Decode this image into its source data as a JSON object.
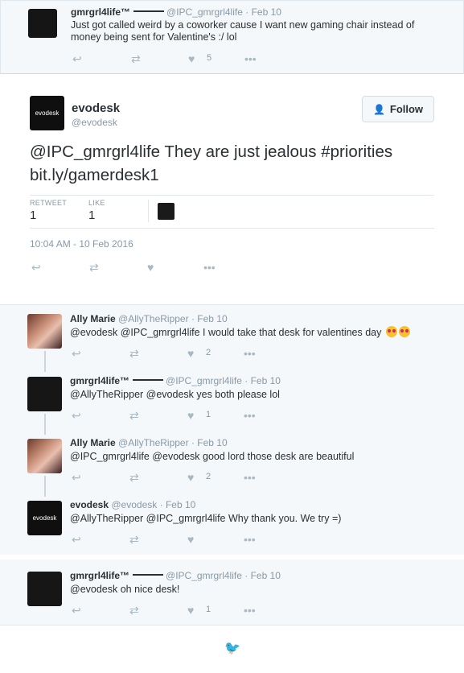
{
  "parent_tweet": {
    "name": "gmrgrl4life™",
    "handle": "@IPC_gmrgrl4life",
    "time": "Feb 10",
    "text": "Just got called weird by a coworker cause I want new gaming chair instead of money being sent for Valentine's :/ lol",
    "like_count": "5"
  },
  "main_tweet": {
    "avatar_text": "evodesk",
    "name": "evodesk",
    "handle": "@evodesk",
    "follow_label": "Follow",
    "text": "@IPC_gmrgrl4life They are just jealous #priorities bit.ly/gamerdesk1",
    "retweet_label": "RETWEET",
    "retweet_count": "1",
    "like_label": "LIKE",
    "like_count": "1",
    "date": "10:04 AM - 10 Feb 2016"
  },
  "replies": [
    {
      "name": "Ally Marie",
      "handle": "@AllyTheRipper",
      "time": "Feb 10",
      "text": "@evodesk @IPC_gmrgrl4life I would take that desk for valentines day",
      "like_count": "2"
    },
    {
      "name": "gmrgrl4life™",
      "handle": "@IPC_gmrgrl4life",
      "time": "Feb 10",
      "text": "@AllyTheRipper @evodesk yes both please lol",
      "like_count": "1"
    },
    {
      "name": "Ally Marie",
      "handle": "@AllyTheRipper",
      "time": "Feb 10",
      "text": "@IPC_gmrgrl4life @evodesk good lord those desk are beautiful",
      "like_count": "2"
    },
    {
      "name": "evodesk",
      "handle": "@evodesk",
      "time": "Feb 10",
      "text": "@AllyTheRipper @IPC_gmrgrl4life Why thank you. We try =)",
      "like_count": "",
      "avatar_text": "evodesk"
    },
    {
      "name": "gmrgrl4life™",
      "handle": "@IPC_gmrgrl4life",
      "time": "Feb 10",
      "text": "@evodesk oh nice desk!",
      "like_count": "1"
    }
  ],
  "separator": "·",
  "icons": {
    "reply": "reply-icon",
    "retweet": "retweet-icon",
    "like": "heart-icon",
    "more": "more-icon",
    "follow": "add-user-icon",
    "footer": "twitter-bird-icon"
  },
  "colors": {
    "accent": "#55acee",
    "muted": "#8899a6",
    "icon": "#aab8c2",
    "background_alt": "#f5f8fa"
  }
}
